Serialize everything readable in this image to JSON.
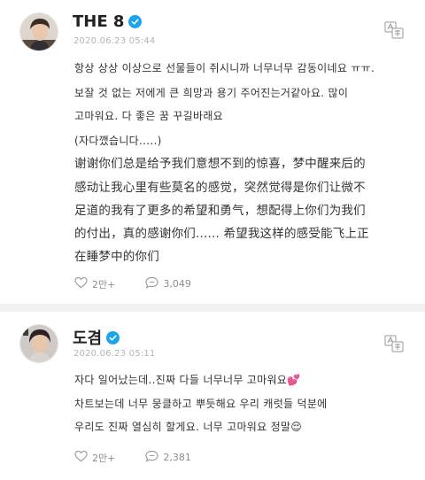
{
  "posts": [
    {
      "author": "THE 8",
      "verified": true,
      "timestamp": "2020.06.23 05:44",
      "lines": [
        "항상 상상 이상으로 선물들이 쥐시니까 너무너무 감동이네요 ㅠㅠ.",
        "보잘 것 없는 저에게 큰 희망과 용기 주어진는거같아요.   많이",
        "고마워요. 다 좋은 꿈 꾸길바래요",
        "(자다깼습니다.....)",
        "谢谢你们总是给予我们意想不到的惊喜，梦中醒来后的",
        "感动让我心里有些莫名的感觉，突然觉得是你们让微不",
        "足道的我有了更多的希望和勇气，想配得上你们为我们",
        "的付出，真的感谢你们...... 希望我这样的感受能飞上正",
        "在睡梦中的你们"
      ],
      "likes": "2만+",
      "comments": "3,049"
    },
    {
      "author": "도겸",
      "verified": true,
      "timestamp": "2020.06.23 05:11",
      "lines": [
        "자다 일어났는데..진짜 다들 너무너무 고마워요",
        "차트보는데 너무 뭉클하고 뿌듯해요 우리 캐럿들 덕분에",
        "우리도 진짜 열심히 할게요. 너무 고마워요 정말"
      ],
      "emoji": [
        "💕",
        "😌"
      ],
      "likes": "2만+",
      "comments": "2,381"
    }
  ],
  "icons": {
    "verified": "verified-badge-icon",
    "translate": "translate-icon",
    "like": "heart-icon",
    "comment": "comment-bubble-icon"
  },
  "colors": {
    "verified": "#1aa4ec",
    "text": "#333333",
    "meta": "#b4b4b4",
    "divider": "#f2f2f2"
  }
}
